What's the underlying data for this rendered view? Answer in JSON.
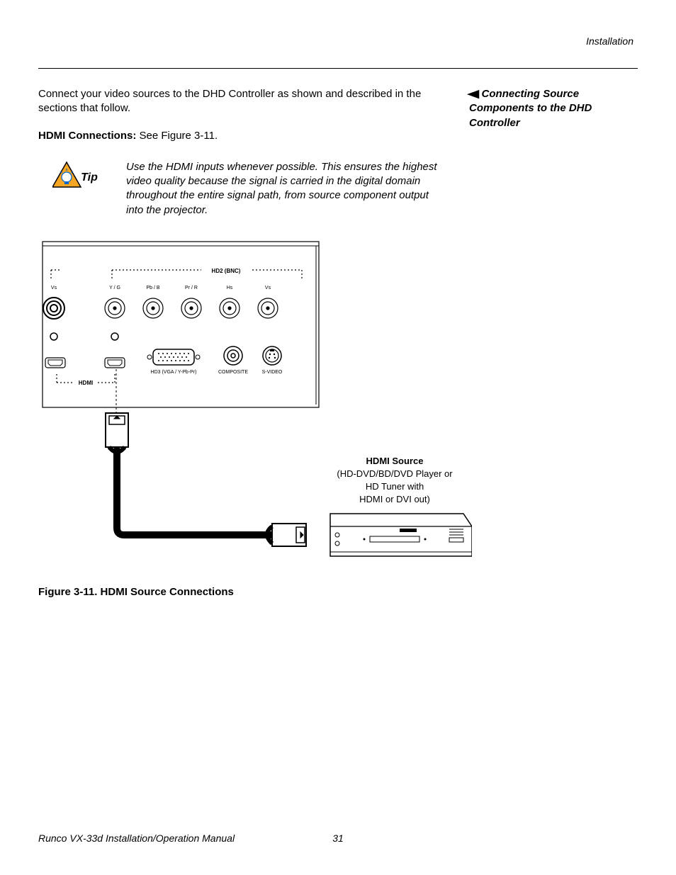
{
  "header": {
    "running": "Installation"
  },
  "side": {
    "heading_line1": "Connecting Source",
    "heading_line2": "Components to the DHD",
    "heading_line3": "Controller"
  },
  "body": {
    "intro": "Connect your video sources to the DHD Controller as shown and described in the sections that follow.",
    "hdmi_label": "HDMI Connections: ",
    "hdmi_rest": "See Figure 3-11."
  },
  "tip": {
    "label": "Tip",
    "text": "Use the HDMI inputs whenever possible. This ensures the highest video quality because the signal is carried in the digital domain throughout the entire signal path, from source component output into the projector."
  },
  "diagram": {
    "hd2": "HD2 (BNC)",
    "vs": "Vs",
    "yg": "Y / G",
    "pbb": "Pb / B",
    "prr": "Pr / R",
    "hs": "Hs",
    "hd3": "HD3 (VGA / Y-Pb-Pr)",
    "composite": "COMPOSITE",
    "svideo": "S-VIDEO",
    "hdmi": "HDMI",
    "src_title": "HDMI Source",
    "src_l1": "(HD-DVD/BD/DVD Player or",
    "src_l2": "HD Tuner with",
    "src_l3": "HDMI or DVI out)"
  },
  "figure": {
    "caption": "Figure 3-11. HDMI Source Connections"
  },
  "footer": {
    "manual": "Runco VX-33d Installation/Operation Manual",
    "page": "31"
  }
}
